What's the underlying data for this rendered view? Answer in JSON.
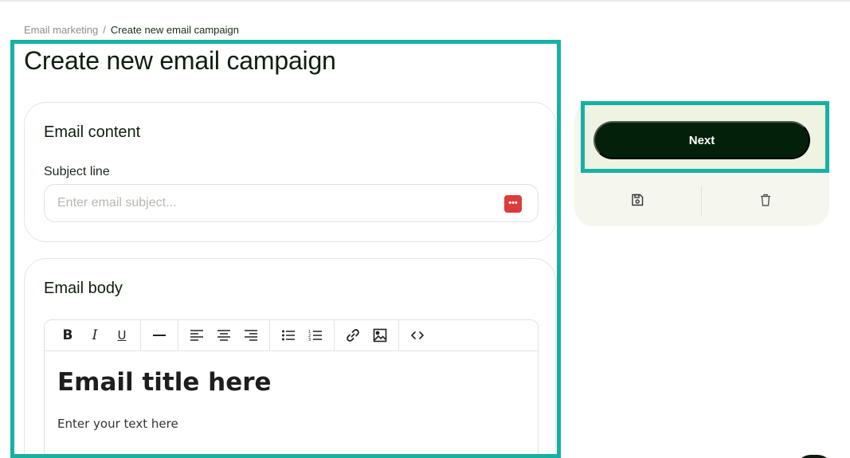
{
  "breadcrumb": {
    "parent": "Email marketing",
    "separator": "/",
    "current": "Create new email campaign"
  },
  "page": {
    "title": "Create new email campaign"
  },
  "email_content": {
    "title": "Email content",
    "subject_label": "Subject line",
    "subject_placeholder": "Enter email subject...",
    "subject_value": "",
    "password_manager_icon": "•••"
  },
  "email_body": {
    "title": "Email body",
    "toolbar": {
      "bold": "B",
      "italic": "I",
      "underline": "U"
    },
    "editor_title": "Email title here",
    "editor_text": "Enter your text here"
  },
  "actions": {
    "next_label": "Next",
    "save_icon": "save-icon",
    "delete_icon": "trash-icon"
  },
  "colors": {
    "accent_highlight": "#17b0a4",
    "primary_button": "#02200a",
    "side_panel_bg": "#f5f7ee",
    "password_icon": "#dc3c3c"
  }
}
